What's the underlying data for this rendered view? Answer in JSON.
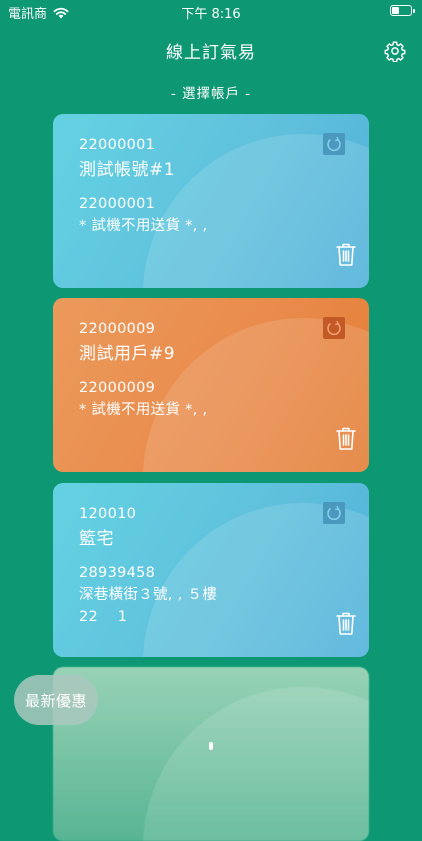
{
  "status_bar": {
    "carrier": "電訊商",
    "time": "下午 8:16",
    "battery_level": 0.35
  },
  "nav": {
    "title": "線上訂氣易"
  },
  "section_label": "- 選擇帳戶 -",
  "accounts": [
    {
      "id": "22000001",
      "name": "測試帳號#1",
      "phone": "22000001",
      "address": "* 試機不用送貨 *, ,",
      "extra": "",
      "color": "#5fbfdc"
    },
    {
      "id": "22000009",
      "name": "測試用戶#9",
      "phone": "22000009",
      "address": "* 試機不用送貨 *, ,",
      "extra": "",
      "color": "#e98a4a"
    },
    {
      "id": "120010",
      "name": "籃宅",
      "phone": "28939458",
      "address": "深巷橫街３號, , ５樓",
      "extra": "22　 1",
      "color": "#5fbfdc"
    }
  ],
  "promo_button": "最新優惠"
}
